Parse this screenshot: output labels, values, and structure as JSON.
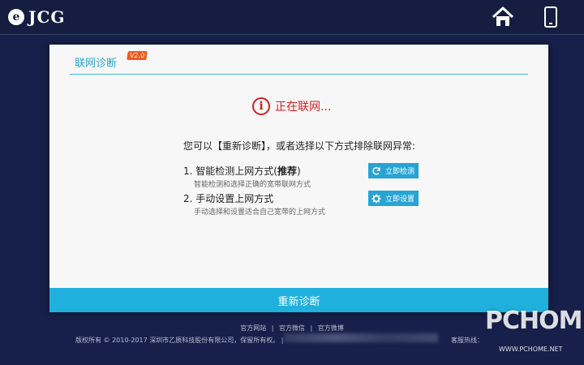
{
  "header": {
    "brand": "JCG",
    "logo_letter": "e"
  },
  "card": {
    "title": "联网诊断",
    "version": "V2.0",
    "status_text": "正在联网...",
    "status_icon_glyph": "i",
    "hint": "您可以【重新诊断】，或者选择以下方式排除联网异常:",
    "items": [
      {
        "title": "1. 智能检测上网方式(",
        "title_bold": "推荐",
        "title_end": ")",
        "subtitle": "智能检测和选择正确的宽带联网方式",
        "button": "立即检测"
      },
      {
        "title": "2. 手动设置上网方式",
        "subtitle": "手动选择和设置适合自己宽带的上网方式",
        "button": "立即设置"
      }
    ],
    "rediagnose_label": "重新诊断"
  },
  "footer": {
    "links": [
      "官方网站",
      "官方微信",
      "官方微博"
    ],
    "separator": "|",
    "copyright": "版权所有 © 2010-2017 深圳市乙辰科技股份有限公司，保留所有权。",
    "copyright_sep": "|",
    "hotline": "客服热线："
  },
  "watermark": {
    "text": "PCHOME",
    "url": "WWW.PCHOME.NET"
  },
  "colors": {
    "background": "#16204a",
    "accent": "#26a6d1",
    "status_red": "#d41f1f",
    "bar_blue": "#1fb0dd"
  }
}
